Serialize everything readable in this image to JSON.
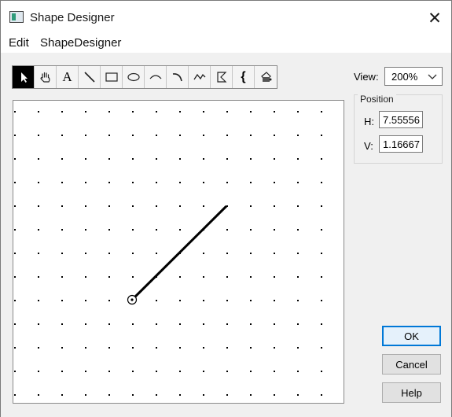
{
  "window": {
    "title": "Shape Designer",
    "close_glyph": "✕"
  },
  "menu": {
    "items": [
      "Edit",
      "ShapeDesigner"
    ]
  },
  "toolbar": {
    "tools": [
      {
        "name": "select-arrow-icon",
        "active": true
      },
      {
        "name": "hand-pan-icon",
        "active": false
      },
      {
        "name": "text-tool-icon",
        "glyph": "A",
        "active": false
      },
      {
        "name": "line-tool-icon",
        "active": false
      },
      {
        "name": "rectangle-tool-icon",
        "active": false
      },
      {
        "name": "ellipse-tool-icon",
        "active": false
      },
      {
        "name": "arc-tool-icon",
        "active": false
      },
      {
        "name": "arc-arrow-tool-icon",
        "active": false
      },
      {
        "name": "freehand-tool-icon",
        "active": false
      },
      {
        "name": "polygon-tool-icon",
        "active": false
      },
      {
        "name": "bracket-tool-icon",
        "glyph": "{",
        "active": false
      },
      {
        "name": "fill-tool-icon",
        "active": false
      }
    ]
  },
  "view": {
    "label": "View:",
    "value": "200%"
  },
  "position": {
    "title": "Position",
    "h_label": "H:",
    "h_value": "7.55556",
    "v_label": "V:",
    "v_value": "1.16667"
  },
  "buttons": {
    "ok": "OK",
    "cancel": "Cancel",
    "help": "Help"
  }
}
